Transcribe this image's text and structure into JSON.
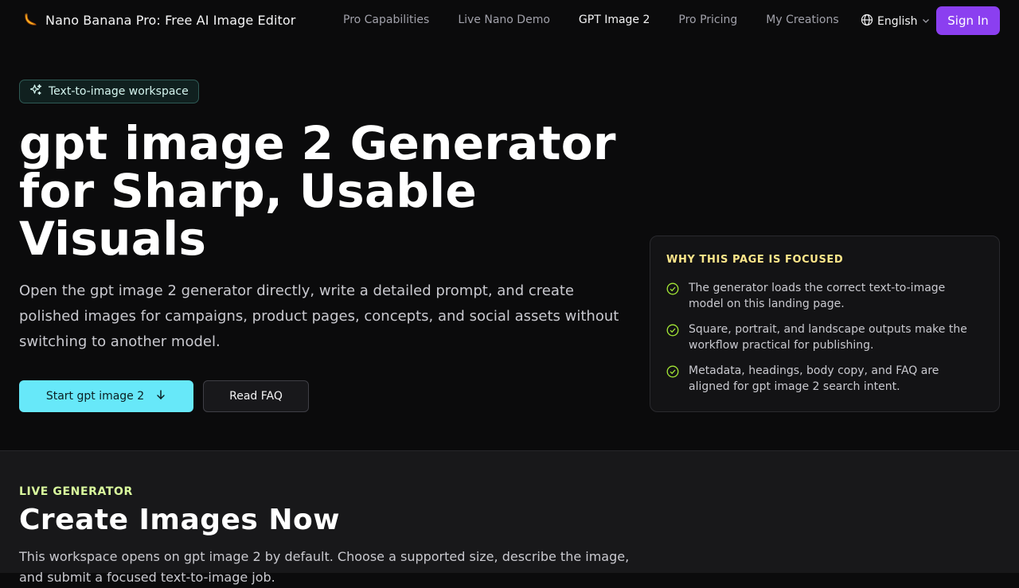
{
  "nav": {
    "brand": "Nano Banana Pro: Free AI Image Editor",
    "items": [
      {
        "label": "Pro Capabilities"
      },
      {
        "label": "Live Nano Demo"
      },
      {
        "label": "GPT Image 2"
      },
      {
        "label": "Pro Pricing"
      },
      {
        "label": "My Creations"
      }
    ],
    "active_item": "GPT Image 2",
    "language": "English",
    "sign_in": "Sign In"
  },
  "hero": {
    "badge": "Text-to-image workspace",
    "title": "gpt image 2 Generator for Sharp, Usable Visuals",
    "description": "Open the gpt image 2 generator directly, write a detailed prompt, and create polished images for campaigns, product pages, concepts, and social assets without switching to another model.",
    "primary_button": "Start gpt image 2",
    "secondary_button": "Read FAQ"
  },
  "focus_card": {
    "title": "WHY THIS PAGE IS FOCUSED",
    "points": [
      "The generator loads the correct text-to-image model on this landing page.",
      "Square, portrait, and landscape outputs make the workflow practical for publishing.",
      "Metadata, headings, body copy, and FAQ are aligned for gpt image 2 search intent."
    ]
  },
  "generator_section": {
    "eyebrow": "LIVE GENERATOR",
    "title": "Create Images Now",
    "description": "This workspace opens on gpt image 2 by default. Choose a supported size, describe the image, and submit a focused text-to-image job."
  },
  "colors": {
    "accent_purple": "#8b3ff0",
    "accent_cyan": "#67e8f9",
    "eyebrow_yellow": "#fde68a",
    "eyebrow_lime": "#d9f99d",
    "check_green": "#a3e635"
  },
  "icons": {
    "brand": "banana-icon",
    "language": "globe-icon",
    "badge": "sparkles-icon",
    "primary_button": "arrow-down-icon",
    "points": "check-circle-icon"
  }
}
